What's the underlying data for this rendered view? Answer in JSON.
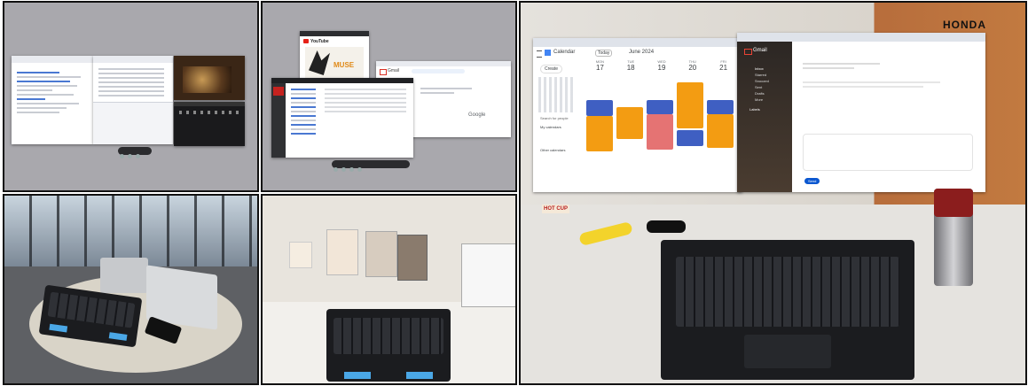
{
  "panels": {
    "top_left": {
      "caption": "Desktop overview with four windows",
      "windows": [
        "document",
        "file-manager",
        "photo-viewer",
        "terminal"
      ]
    },
    "top_middle": {
      "youtube_label": "YouTube",
      "muse_label": "MUSE",
      "gmail_label": "Gmail",
      "google_label": "Google"
    },
    "bottom_left": {
      "caption": "Keyboard case with tablet on outdoor table"
    },
    "bottom_middle": {
      "caption": "Keyboard case on desk with artwork"
    },
    "right": {
      "calendar": {
        "app_label": "Calendar",
        "today_button": "Today",
        "month_label": "June 2024",
        "create_label": "Create",
        "days": [
          {
            "name": "MON",
            "num": "17"
          },
          {
            "name": "TUE",
            "num": "18"
          },
          {
            "name": "WED",
            "num": "19"
          },
          {
            "name": "THU",
            "num": "20"
          },
          {
            "name": "FRI",
            "num": "21"
          }
        ],
        "search_people": "Search for people",
        "my_calendars": "My calendars",
        "other_calendars": "Other calendars"
      },
      "gmail": {
        "app_label": "Gmail",
        "nav": [
          "Inbox",
          "Starred",
          "Snoozed",
          "Sent",
          "Drafts",
          "More"
        ],
        "labels_heading": "Labels",
        "send_button": "Send"
      },
      "sign_text": "HONDA",
      "cup_text": "HOT CUP"
    }
  },
  "colors": {
    "calendar_blue": "#3f5fc2",
    "calendar_orange": "#f39c12",
    "calendar_pink": "#e57373",
    "gmail_dark": "#3b3531",
    "keyboard_accent": "#4aa7e6"
  }
}
